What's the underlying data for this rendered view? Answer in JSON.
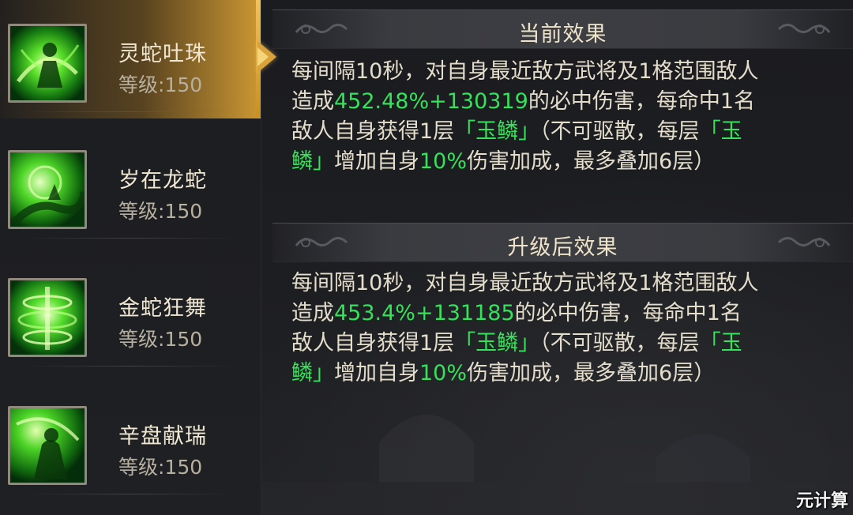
{
  "skills": [
    {
      "name": "灵蛇吐珠",
      "level": "等级:150",
      "selected": true,
      "icon": "green-serpent-orb-icon"
    },
    {
      "name": "岁在龙蛇",
      "level": "等级:150",
      "selected": false,
      "icon": "green-dragon-serpent-icon"
    },
    {
      "name": "金蛇狂舞",
      "level": "等级:150",
      "selected": false,
      "icon": "green-serpent-dance-icon"
    },
    {
      "name": "辛盘献瑞",
      "level": "等级:150",
      "selected": false,
      "icon": "green-auspicious-offering-icon"
    }
  ],
  "current": {
    "title": "当前效果",
    "l1": "每间隔10秒，对自身最近敌方武将及1格范围敌人",
    "l2_pre": "造成",
    "l2_hl": "452.48%+130319",
    "l2_post": "的必中伤害，每命中1名",
    "l3_pre": "敌人自身获得1层",
    "l3_hl": "「玉鳞」",
    "l3_mid": "（不可驱散，每层",
    "l3_hl2": "「玉",
    "l4_hl": "鳞」",
    "l4_mid": "增加自身",
    "l4_hl2": "10%",
    "l4_post": "伤害加成，最多叠加6层）"
  },
  "upgrade": {
    "title": "升级后效果",
    "l1": "每间隔10秒，对自身最近敌方武将及1格范围敌人",
    "l2_pre": "造成",
    "l2_hl": "453.4%+131185",
    "l2_post": "的必中伤害，每命中1名",
    "l3_pre": "敌人自身获得1层",
    "l3_hl": "「玉鳞」",
    "l3_mid": "（不可驱散，每层",
    "l3_hl2": "「玉",
    "l4_hl": "鳞」",
    "l4_mid": "增加自身",
    "l4_hl2": "10%",
    "l4_post": "伤害加成，最多叠加6层）"
  },
  "colors": {
    "highlight": "#35e35a",
    "selected_gold": "#d9a23a",
    "text": "#e4ddcc"
  },
  "watermark": "元计算"
}
